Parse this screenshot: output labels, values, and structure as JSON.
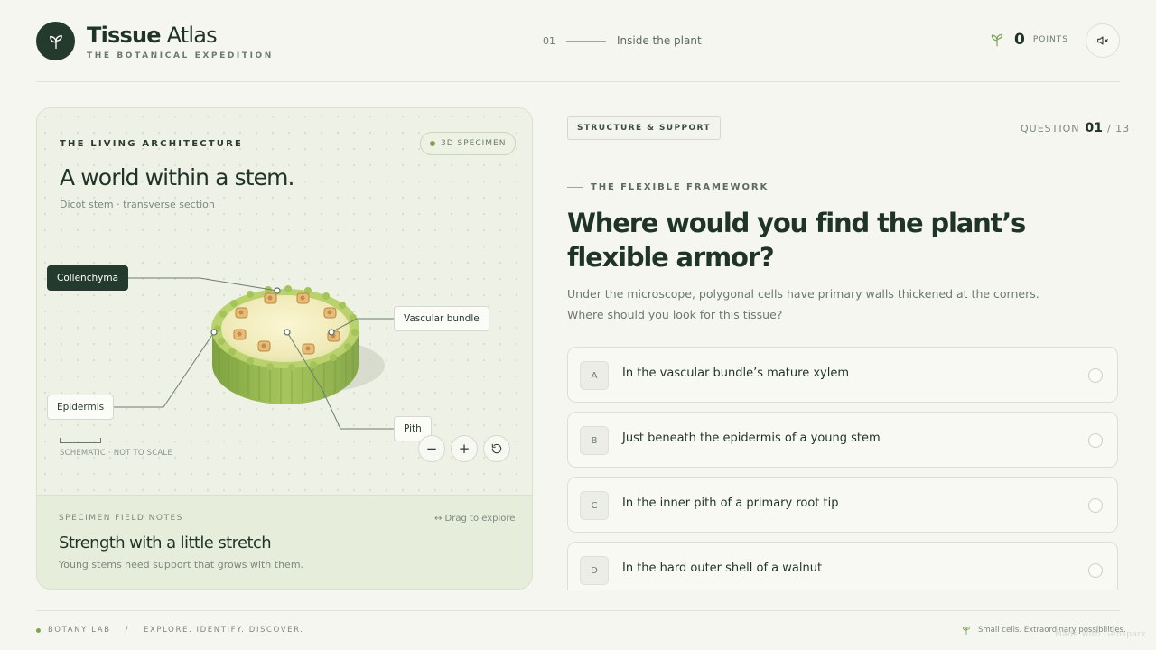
{
  "header": {
    "brand_title_bold": "Tissue",
    "brand_title_light": "Atlas",
    "brand_subtitle": "THE BOTANICAL EXPEDITION",
    "chapter_number": "01",
    "chapter_title": "Inside the plant",
    "points_value": "0",
    "points_label": "POINTS",
    "logo_icon": "sprout-icon",
    "points_icon": "sprout-icon",
    "mute_icon": "speaker-muted-icon"
  },
  "specimen_panel": {
    "eyebrow": "THE LIVING ARCHITECTURE",
    "badge": "3D SPECIMEN",
    "title": "A world within a stem.",
    "subtitle": "Dicot stem · transverse section",
    "callouts": {
      "collenchyma": "Collenchyma",
      "vascular_bundle": "Vascular bundle",
      "epidermis": "Epidermis",
      "pith": "Pith"
    },
    "scale_label": "SCHEMATIC · NOT TO SCALE",
    "controls": {
      "zoom_out": "−",
      "zoom_in": "+",
      "reset_icon": "reset-icon"
    },
    "field_notes": {
      "eyebrow": "SPECIMEN FIELD NOTES",
      "drag_hint": "↔ Drag to explore",
      "title": "Strength with a little stretch",
      "subtitle": "Young stems need support that grows with them."
    }
  },
  "question": {
    "category_tag": "STRUCTURE & SUPPORT",
    "count_label": "QUESTION",
    "current": "01",
    "total": "/ 13",
    "eyebrow": "THE FLEXIBLE FRAMEWORK",
    "title": "Where would you find the plant’s flexible armor?",
    "description": "Under the microscope, polygonal cells have primary walls thickened at the corners. Where should you look for this tissue?",
    "answers": [
      {
        "letter": "A",
        "text": "In the vascular bundle’s mature xylem"
      },
      {
        "letter": "B",
        "text": "Just beneath the epidermis of a young stem"
      },
      {
        "letter": "C",
        "text": "In the inner pith of a primary root tip"
      },
      {
        "letter": "D",
        "text": "In the hard outer shell of a walnut"
      }
    ]
  },
  "footer": {
    "lab": "BOTANY LAB",
    "separator": "/",
    "tagline": "EXPLORE. IDENTIFY. DISCOVER.",
    "right_text": "Small cells. Extraordinary possibilities.",
    "watermark": "Made with Genspark"
  },
  "colors": {
    "accent_dark": "#243a2e",
    "accent_green": "#7fa25a",
    "background": "#f6f6f0"
  }
}
